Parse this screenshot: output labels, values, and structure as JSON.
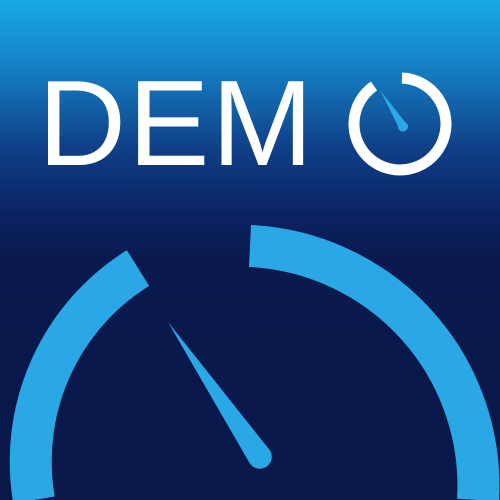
{
  "logo": {
    "text": "DEMO",
    "icon": "speedometer-gauge-icon"
  },
  "colors": {
    "gradient_top": "#17a9e6",
    "gradient_bottom": "#091749",
    "gauge_accent": "#2aa8e6",
    "text": "#ffffff"
  }
}
